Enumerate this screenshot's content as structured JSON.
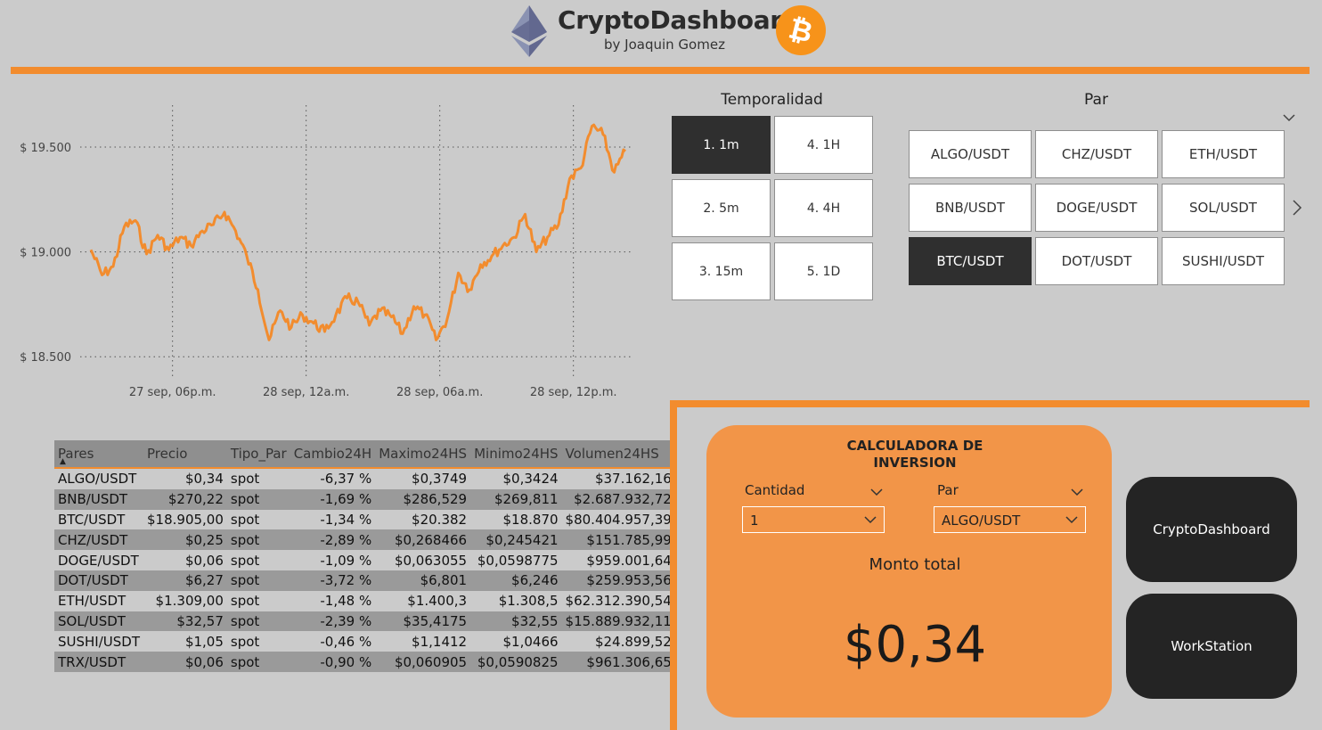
{
  "header": {
    "title": "CryptoDashboard",
    "subtitle": "by Joaquin Gomez",
    "left_logo": "ethereum-logo",
    "right_logo": "bitcoin-logo",
    "accent_color": "#f28c2e"
  },
  "chart_data": {
    "type": "line",
    "title": "",
    "xlabel": "",
    "ylabel": "",
    "x_ticks": [
      "27 sep, 06p.m.",
      "28 sep, 12a.m.",
      "28 sep, 06a.m.",
      "28 sep, 12p.m."
    ],
    "y_ticks": [
      "$ 18.500",
      "$ 19.000",
      "$ 19.500"
    ],
    "ylim": [
      18450,
      19700
    ],
    "grid": true,
    "series": [
      {
        "color": "#f28c2e",
        "x": [
          "2022-09-27 14:20",
          "2022-09-27 14:50",
          "2022-09-27 15:20",
          "2022-09-27 15:50",
          "2022-09-27 16:20",
          "2022-09-27 16:50",
          "2022-09-27 17:20",
          "2022-09-27 17:50",
          "2022-09-27 18:20",
          "2022-09-27 18:50",
          "2022-09-27 19:20",
          "2022-09-27 19:50",
          "2022-09-27 20:20",
          "2022-09-27 20:50",
          "2022-09-27 21:20",
          "2022-09-27 21:50",
          "2022-09-27 22:20",
          "2022-09-27 22:50",
          "2022-09-27 23:20",
          "2022-09-27 23:50",
          "2022-09-28 00:20",
          "2022-09-28 00:50",
          "2022-09-28 01:20",
          "2022-09-28 01:50",
          "2022-09-28 02:20",
          "2022-09-28 02:50",
          "2022-09-28 03:20",
          "2022-09-28 03:50",
          "2022-09-28 04:20",
          "2022-09-28 04:50",
          "2022-09-28 05:20",
          "2022-09-28 05:50",
          "2022-09-28 06:20",
          "2022-09-28 06:50",
          "2022-09-28 07:20",
          "2022-09-28 07:50",
          "2022-09-28 08:20",
          "2022-09-28 08:50",
          "2022-09-28 09:20",
          "2022-09-28 09:50",
          "2022-09-28 10:20",
          "2022-09-28 10:50",
          "2022-09-28 11:20",
          "2022-09-28 11:50",
          "2022-09-28 12:20",
          "2022-09-28 12:50",
          "2022-09-28 13:20",
          "2022-09-28 13:50",
          "2022-09-28 14:20"
        ],
        "y": [
          19010,
          18890,
          18930,
          19120,
          19150,
          18990,
          19080,
          19010,
          19070,
          19030,
          19100,
          19130,
          19190,
          19100,
          18980,
          18820,
          18580,
          18720,
          18640,
          18700,
          18660,
          18620,
          18700,
          18780,
          18760,
          18650,
          18720,
          18690,
          18610,
          18740,
          18700,
          18580,
          18680,
          18900,
          18820,
          18940,
          18980,
          19030,
          19070,
          19180,
          19000,
          19070,
          19130,
          19350,
          19400,
          19600,
          19560,
          19380,
          19480
        ]
      }
    ]
  },
  "temporalidad": {
    "title": "Temporalidad",
    "options": [
      "1. 1m",
      "4. 1H",
      "2. 5m",
      "4. 4H",
      "3. 15m",
      "5. 1D"
    ],
    "selected": "1. 1m"
  },
  "par": {
    "title": "Par",
    "options": [
      "ALGO/USDT",
      "CHZ/USDT",
      "ETH/USDT",
      "BNB/USDT",
      "DOGE/USDT",
      "SOL/USDT",
      "BTC/USDT",
      "DOT/USDT",
      "SUSHI/USDT"
    ],
    "selected": "BTC/USDT",
    "expand_icon": "chevron-down-icon",
    "next_icon": "chevron-right-icon"
  },
  "table": {
    "columns": [
      "Pares",
      "Precio",
      "Tipo_Par",
      "Cambio24H",
      "Maximo24HS",
      "Minimo24HS",
      "Volumen24HS"
    ],
    "sort_icon": "sort-ascending-icon",
    "rows": [
      [
        "ALGO/USDT",
        "$0,34",
        "spot",
        "-6,37 %",
        "$0,3749",
        "$0,3424",
        "$37.162,16"
      ],
      [
        "BNB/USDT",
        "$270,22",
        "spot",
        "-1,69 %",
        "$286,529",
        "$269,811",
        "$2.687.932,72"
      ],
      [
        "BTC/USDT",
        "$18.905,00",
        "spot",
        "-1,34 %",
        "$20.382",
        "$18.870",
        "$80.404.957,39"
      ],
      [
        "CHZ/USDT",
        "$0,25",
        "spot",
        "-2,89 %",
        "$0,268466",
        "$0,245421",
        "$151.785,99"
      ],
      [
        "DOGE/USDT",
        "$0,06",
        "spot",
        "-1,09 %",
        "$0,063055",
        "$0,0598775",
        "$959.001,64"
      ],
      [
        "DOT/USDT",
        "$6,27",
        "spot",
        "-3,72 %",
        "$6,801",
        "$6,246",
        "$259.953,56"
      ],
      [
        "ETH/USDT",
        "$1.309,00",
        "spot",
        "-1,48 %",
        "$1.400,3",
        "$1.308,5",
        "$62.312.390,54"
      ],
      [
        "SOL/USDT",
        "$32,57",
        "spot",
        "-2,39 %",
        "$35,4175",
        "$32,55",
        "$15.889.932,11"
      ],
      [
        "SUSHI/USDT",
        "$1,05",
        "spot",
        "-0,46 %",
        "$1,1412",
        "$1,0466",
        "$24.899,52"
      ],
      [
        "TRX/USDT",
        "$0,06",
        "spot",
        "-0,90 %",
        "$0,060905",
        "$0,0590825",
        "$961.306,65"
      ]
    ]
  },
  "calculator": {
    "title_line1": "CALCULADORA DE",
    "title_line2": "INVERSION",
    "cantidad_label": "Cantidad",
    "cantidad_value": "1",
    "par_label": "Par",
    "par_value": "ALGO/USDT",
    "total_label": "Monto total",
    "total_value": "$0,34"
  },
  "nav": {
    "dashboard_button": "CryptoDashboard",
    "workstation_button": "WorkStation"
  }
}
